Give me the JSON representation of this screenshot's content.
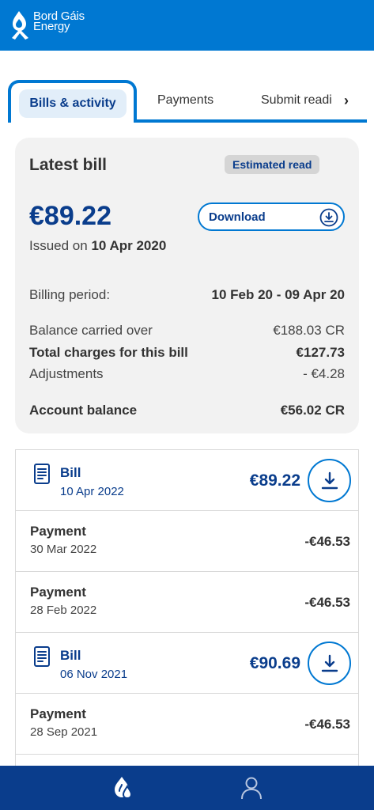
{
  "header": {
    "logo_line1": "Bord Gáis",
    "logo_line2": "Energy"
  },
  "tabs": [
    {
      "label": "Bills & activity",
      "active": true
    },
    {
      "label": "Payments"
    },
    {
      "label": "Submit readi"
    }
  ],
  "latest_bill": {
    "title": "Latest bill",
    "badge": "Estimated read",
    "amount": "€89.22",
    "issued_prefix": "Issued on",
    "issued_date": "10 Apr 2020",
    "download_label": "Download",
    "billing_period_label": "Billing period:",
    "billing_period_value": "10 Feb 20 - 09 Apr 20",
    "balance_carried_label": "Balance carried over",
    "balance_carried_value": "€188.03 CR",
    "total_charges_label": "Total charges for this bill",
    "total_charges_value": "€127.73",
    "adjustments_label": "Adjustments",
    "adjustments_value": "- €4.28",
    "account_balance_label": "Account balance",
    "account_balance_value": "€56.02 CR"
  },
  "activity": [
    {
      "type": "bill",
      "name": "Bill",
      "date": "10 Apr 2022",
      "amount": "€89.22"
    },
    {
      "type": "payment",
      "name": "Payment",
      "date": "30 Mar 2022",
      "amount": "-€46.53"
    },
    {
      "type": "payment",
      "name": "Payment",
      "date": "28 Feb 2022",
      "amount": "-€46.53"
    },
    {
      "type": "bill",
      "name": "Bill",
      "date": "06 Nov 2021",
      "amount": "€90.69"
    },
    {
      "type": "payment",
      "name": "Payment",
      "date": "28 Sep 2021",
      "amount": "-€46.53"
    }
  ],
  "colors": {
    "brand": "#0078d2",
    "navy": "#0a3d8c",
    "card": "#f2f2f2"
  },
  "icons": {
    "home": "flame-drop-icon",
    "account": "user-icon",
    "download": "download-icon",
    "document": "document-icon"
  }
}
